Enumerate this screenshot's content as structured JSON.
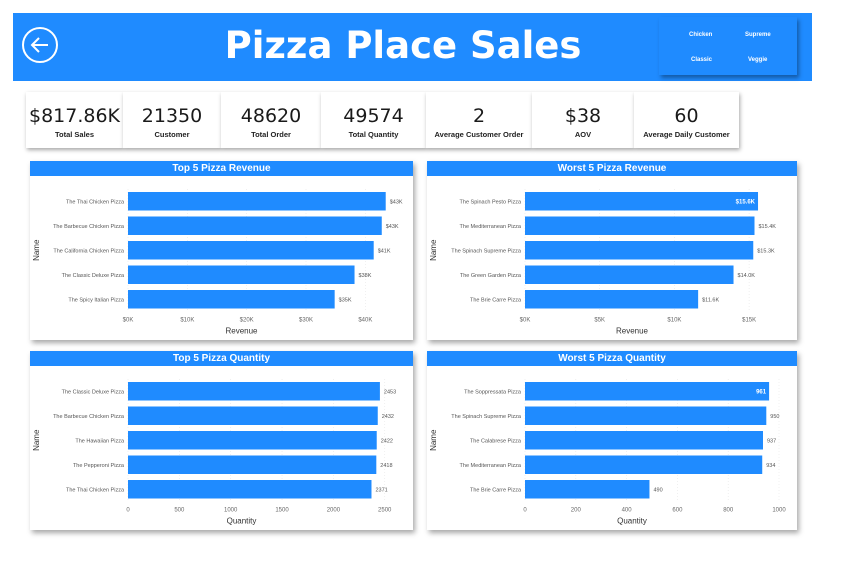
{
  "header": {
    "title": "Pizza Place Sales",
    "slicer": [
      "Chicken",
      "Supreme",
      "Classic",
      "Veggie"
    ]
  },
  "kpis": [
    {
      "value": "$817.86K",
      "label": "Total Sales"
    },
    {
      "value": "21350",
      "label": "Customer"
    },
    {
      "value": "48620",
      "label": "Total Order"
    },
    {
      "value": "49574",
      "label": "Total Quantity"
    },
    {
      "value": "2",
      "label": "Average Customer Order"
    },
    {
      "value": "$38",
      "label": "AOV"
    },
    {
      "value": "60",
      "label": "Average Daily Customer"
    }
  ],
  "colors": {
    "accent": "#1f8bff",
    "bar": "#1f8bff"
  },
  "chart_data": [
    {
      "type": "bar",
      "orientation": "horizontal",
      "title": "Top 5 Pizza Revenue",
      "xlabel": "Revenue",
      "ylabel": "Name",
      "categories": [
        "The Thai Chicken Pizza",
        "The Barbecue Chicken Pizza",
        "The California Chicken Pizza",
        "The Classic Deluxe Pizza",
        "The Spicy Italian Pizza"
      ],
      "values": [
        43434,
        42768,
        41410,
        38180,
        34831
      ],
      "data_labels": [
        "$43K",
        "$43K",
        "$41K",
        "$38K",
        "$35K"
      ],
      "xlim": [
        0,
        45000
      ],
      "xticks": [
        0,
        10000,
        20000,
        30000,
        40000
      ],
      "xtick_labels": [
        "$0K",
        "$10K",
        "$20K",
        "$30K",
        "$40K"
      ]
    },
    {
      "type": "bar",
      "orientation": "horizontal",
      "title": "Worst 5 Pizza Revenue",
      "xlabel": "Revenue",
      "ylabel": "Name",
      "categories": [
        "The Spinach Pesto Pizza",
        "The Mediterranean Pizza",
        "The Spinach Supreme Pizza",
        "The Green Garden Pizza",
        "The Brie Carre Pizza"
      ],
      "values": [
        15596,
        15360,
        15277,
        13956,
        11588
      ],
      "data_labels": [
        "$15.6K",
        "$15.4K",
        "$15.3K",
        "$14.0K",
        "$11.6K"
      ],
      "xlim": [
        0,
        17000
      ],
      "xticks": [
        0,
        5000,
        10000,
        15000
      ],
      "xtick_labels": [
        "$0K",
        "$5K",
        "$10K",
        "$15K"
      ]
    },
    {
      "type": "bar",
      "orientation": "horizontal",
      "title": "Top 5 Pizza Quantity",
      "xlabel": "Quantity",
      "ylabel": "Name",
      "categories": [
        "The Classic Deluxe Pizza",
        "The Barbecue Chicken Pizza",
        "The Hawaiian Pizza",
        "The Pepperoni Pizza",
        "The Thai Chicken Pizza"
      ],
      "values": [
        2453,
        2432,
        2422,
        2418,
        2371
      ],
      "data_labels": [
        "2453",
        "2432",
        "2422",
        "2418",
        "2371"
      ],
      "xlim": [
        0,
        2600
      ],
      "xticks": [
        0,
        500,
        1000,
        1500,
        2000,
        2500
      ],
      "xtick_labels": [
        "0",
        "500",
        "1000",
        "1500",
        "2000",
        "2500"
      ]
    },
    {
      "type": "bar",
      "orientation": "horizontal",
      "title": "Worst 5 Pizza Quantity",
      "xlabel": "Quantity",
      "ylabel": "Name",
      "categories": [
        "The Soppressata Pizza",
        "The Spinach Supreme Pizza",
        "The Calabrese Pizza",
        "The Mediterranean Pizza",
        "The Brie Carre Pizza"
      ],
      "values": [
        961,
        950,
        937,
        934,
        490
      ],
      "data_labels": [
        "961",
        "950",
        "937",
        "934",
        "490"
      ],
      "xlim": [
        0,
        1000
      ],
      "xticks": [
        0,
        200,
        400,
        600,
        800,
        1000
      ],
      "xtick_labels": [
        "0",
        "200",
        "400",
        "600",
        "800",
        "1000"
      ]
    }
  ]
}
